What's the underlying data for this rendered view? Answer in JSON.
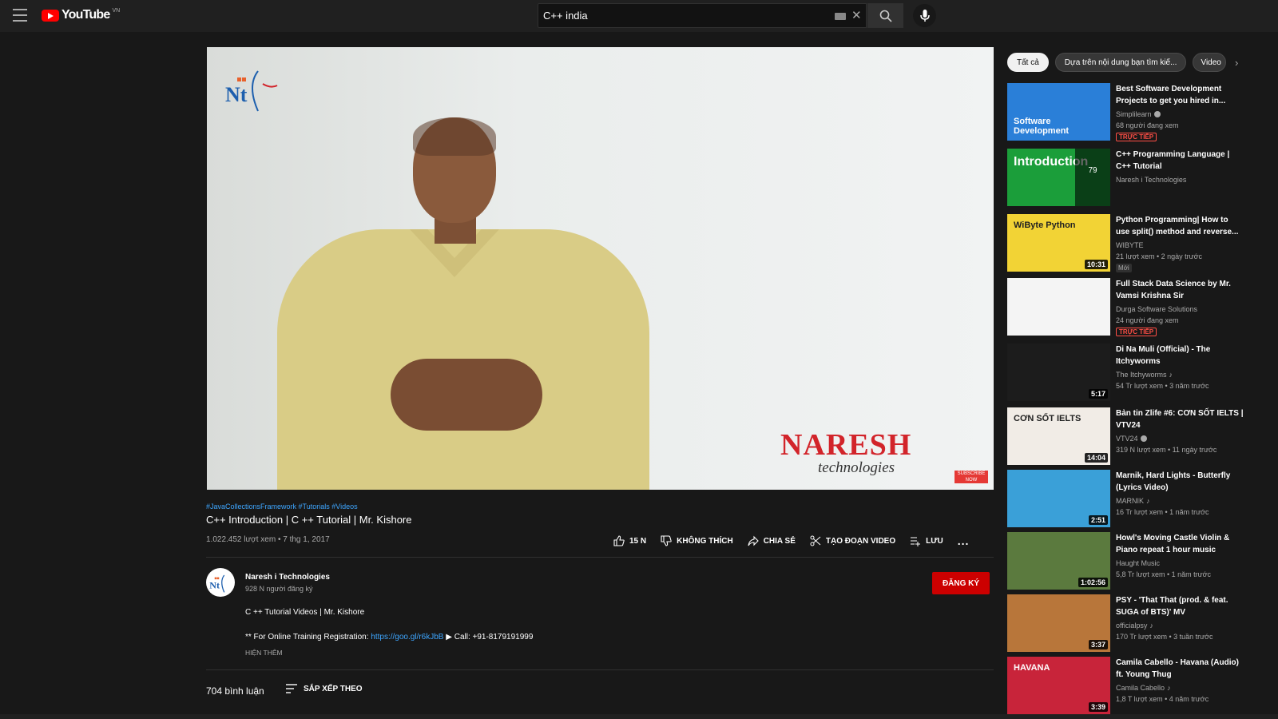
{
  "header": {
    "logo_text": "YouTube",
    "logo_country": "VN",
    "search_value": "C++ india"
  },
  "player": {
    "brand_main": "NARESH",
    "brand_sub": "technologies",
    "subscribe_tag": "SUBSCRIBE NOW"
  },
  "video": {
    "hashtags": "#JavaCollectionsFramework #Tutorials #Videos",
    "title": "C++ Introduction | C ++ Tutorial | Mr. Kishore",
    "meta": "1.022.452 lượt xem • 7 thg 1, 2017",
    "actions": {
      "like": "15 N",
      "dislike": "KHÔNG THÍCH",
      "share": "CHIA SẺ",
      "clip": "TẠO ĐOẠN VIDEO",
      "save": "LƯU",
      "more": "..."
    }
  },
  "channel": {
    "name": "Naresh i Technologies",
    "subscribers": "928 N người đăng ký",
    "subscribe_label": "ĐĂNG KÝ"
  },
  "description": {
    "line1": "C ++ Tutorial Videos | Mr. Kishore",
    "line2_prefix": "** For Online Training Registration: ",
    "line2_link": "https://goo.gl/r6kJbB",
    "line2_suffix": " ▶ Call: +91-8179191999",
    "show_more": "HIỆN THÊM"
  },
  "comments": {
    "count": "704 bình luận",
    "sort_label": "SẮP XẾP THEO"
  },
  "sidebar": {
    "chips": [
      "Tất cả",
      "Dựa trên nội dung bạn tìm kiế...",
      "Video"
    ],
    "recommendations": [
      {
        "title": "Best Software Development Projects to get you hired in...",
        "channel": "Simplilearn",
        "verified": true,
        "stats": "68 người đang xem",
        "badge": "TRỰC TIẾP",
        "duration": "",
        "thumb_color": "#2a7fd8",
        "thumb_text": "Software Development"
      },
      {
        "title": "C++ Programming Language | C++ Tutorial",
        "channel": "Naresh i Technologies",
        "verified": false,
        "stats": "",
        "badge": "",
        "duration": "",
        "thumb_color": "#1b9e3a",
        "thumb_text": "Introduction",
        "playlist_count": "79"
      },
      {
        "title": "Python Programming| How to use split() method and reverse...",
        "channel": "WIBYTE",
        "verified": false,
        "stats": "21 lượt xem • 2 ngày trước",
        "badge": "Mới",
        "duration": "10:31",
        "thumb_color": "#f2d335",
        "thumb_text": "WiByte Python"
      },
      {
        "title": "Full Stack Data Science by Mr. Vamsi Krishna Sir",
        "channel": "Durga Software Solutions",
        "verified": false,
        "stats": "24 người đang xem",
        "badge": "TRỰC TIẾP",
        "duration": "",
        "thumb_color": "#f4f4f4",
        "thumb_text": ""
      },
      {
        "title": "Di Na Muli (Official) - The Itchyworms",
        "channel": "The Itchyworms",
        "verified": false,
        "music": true,
        "stats": "54 Tr lượt xem • 3 năm trước",
        "badge": "",
        "duration": "5:17",
        "thumb_color": "#1c1c1c",
        "thumb_text": ""
      },
      {
        "title": "Bản tin Zlife #6: CƠN SỐT IELTS | VTV24",
        "channel": "VTV24",
        "verified": true,
        "stats": "319 N lượt xem • 11 ngày trước",
        "badge": "",
        "duration": "14:04",
        "thumb_color": "#f1ece6",
        "thumb_text": "CƠN SỐT IELTS"
      },
      {
        "title": "Marnik, Hard Lights - Butterfly (Lyrics Video)",
        "channel": "MARNIK",
        "verified": false,
        "music": true,
        "stats": "16 Tr lượt xem • 1 năm trước",
        "badge": "",
        "duration": "2:51",
        "thumb_color": "#3aa0d8",
        "thumb_text": ""
      },
      {
        "title": "Howl's Moving Castle Violin & Piano repeat 1 hour music",
        "channel": "Haught Music",
        "verified": false,
        "stats": "5,8 Tr lượt xem • 1 năm trước",
        "badge": "",
        "duration": "1:02:56",
        "thumb_color": "#5b7a3e",
        "thumb_text": ""
      },
      {
        "title": "PSY - 'That That (prod. & feat. SUGA of BTS)' MV",
        "channel": "officialpsy",
        "verified": false,
        "music": true,
        "stats": "170 Tr lượt xem • 3 tuần trước",
        "badge": "",
        "duration": "3:37",
        "thumb_color": "#b8763a",
        "thumb_text": ""
      },
      {
        "title": "Camila Cabello - Havana (Audio) ft. Young Thug",
        "channel": "Camila Cabello",
        "verified": false,
        "music": true,
        "stats": "1,8 T lượt xem • 4 năm trước",
        "badge": "",
        "duration": "3:39",
        "thumb_color": "#c8243a",
        "thumb_text": "HAVANA"
      }
    ]
  },
  "colors": {
    "background": "#181818",
    "topbar": "#202020",
    "accent_red": "#cc0000",
    "link_blue": "#3ea6ff"
  }
}
